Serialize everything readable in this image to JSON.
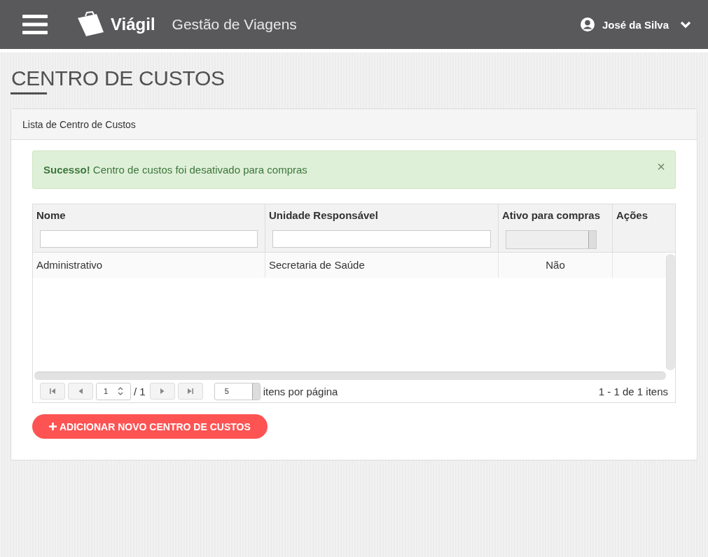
{
  "header": {
    "brand": "Viágil",
    "subtitle": "Gestão de Viagens",
    "user": "José da Silva"
  },
  "page_title": "CENTRO DE CUSTOS",
  "panel": {
    "title": "Lista de Centro de Custos",
    "alert": {
      "text": "**Sucesso!** Centro de custos foi desativado para compras",
      "close": "×"
    },
    "table": {
      "columns": [
        {
          "label": "Nome",
          "kind": "text"
        },
        {
          "label": "Unidade Responsável",
          "kind": "text"
        },
        {
          "label": "Ativo para compras",
          "kind": "select"
        },
        {
          "label": "Ações",
          "kind": "none"
        }
      ],
      "rows": [
        {
          "cells": [
            "Administrativo",
            "Secretaria de Saúde",
            "Não"
          ]
        }
      ]
    },
    "pager": {
      "page": "1",
      "total": "/ 1",
      "page_size": "5",
      "page_size_label": "itens por página",
      "summary": "1 - 1 de 1 itens"
    },
    "add_button": "ADICIONAR NOVO CENTRO DE CUSTOS"
  }
}
